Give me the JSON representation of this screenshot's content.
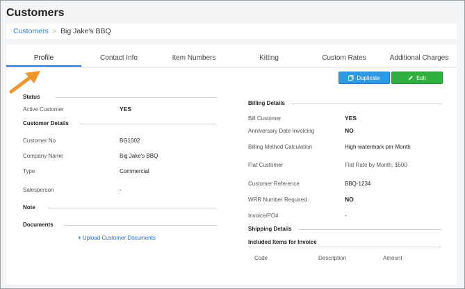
{
  "page": {
    "title": "Customers"
  },
  "breadcrumb": {
    "root": "Customers",
    "separator": ">",
    "current": "Big Jake's BBQ"
  },
  "tabs": [
    {
      "label": "Profile",
      "active": true
    },
    {
      "label": "Contact Info"
    },
    {
      "label": "Item Numbers"
    },
    {
      "label": "Kitting"
    },
    {
      "label": "Custom Rates"
    },
    {
      "label": "Additional Charges"
    }
  ],
  "actions": {
    "duplicate_label": "Duplicate",
    "edit_label": "Edit"
  },
  "colors": {
    "accent": "#2a7bd6",
    "duplicate_bg": "#2d9be3",
    "edit_bg": "#2eaf3e",
    "arrow": "#f0952c"
  },
  "left": {
    "status_heading": "Status",
    "active_customer": {
      "label": "Active Customer",
      "value": "YES"
    },
    "customer_details_heading": "Customer Details",
    "customer_no": {
      "label": "Customer No",
      "value": "BG1002"
    },
    "company_name": {
      "label": "Company Name",
      "value": "Big Jake's BBQ"
    },
    "type": {
      "label": "Type",
      "value": "Commercial"
    },
    "salesperson": {
      "label": "Salesperson",
      "value": "-"
    },
    "note_heading": "Note",
    "documents_heading": "Documents",
    "upload_link": "Upload Customer Documents"
  },
  "right": {
    "billing_heading": "Billing Details",
    "bill_customer": {
      "label": "Bill Customer",
      "value": "YES"
    },
    "anniversary": {
      "label": "Anniversary Date Invoicing",
      "value": "NO"
    },
    "billing_method": {
      "label": "Billing Method Calculation",
      "value": "High-watermark per Month"
    },
    "flat_customer": {
      "label": "Flat Customer",
      "value": "Flat Rate by Month, $500"
    },
    "customer_reference": {
      "label": "Customer Reference",
      "value": "BBQ-1234"
    },
    "wrr": {
      "label": "WRR Number Required",
      "value": "NO"
    },
    "invoice_po": {
      "label": "Invoice/PO#",
      "value": "-"
    },
    "shipping_heading": "Shipping Details",
    "included_heading": "Included Items for Invoice",
    "included_columns": [
      "Code",
      "Description",
      "Amount"
    ]
  }
}
